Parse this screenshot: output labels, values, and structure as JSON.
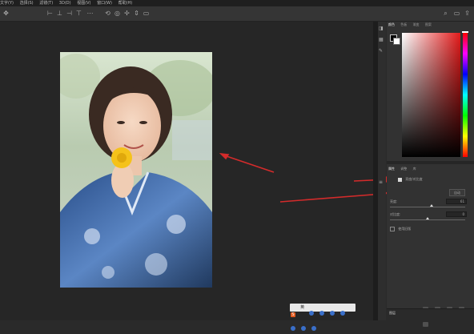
{
  "menubar": {
    "items": [
      "文字(Y)",
      "选择(S)",
      "滤镜(T)",
      "3D(D)",
      "视图(V)",
      "窗口(W)",
      "帮助(H)"
    ]
  },
  "options_bar": {
    "icons": [
      "move-tool",
      "align-left",
      "align-center",
      "align-right",
      "align-top",
      "align-middle",
      "align-bottom",
      "more-dots",
      "3d-rotate",
      "3d-roll",
      "3d-pan",
      "3d-slide",
      "3d-scale",
      "video-icon"
    ]
  },
  "color_panel": {
    "tabs": [
      "颜色",
      "色板",
      "渐变",
      "图案"
    ],
    "active_tab": "颜色",
    "gradient_hue": "#e31b1b"
  },
  "properties_panel": {
    "tabs": [
      "属性",
      "调整",
      "库"
    ],
    "active_tab": "属性",
    "layer_type": "亮度/对比度",
    "auto_button": "自动",
    "brightness_label": "亮度:",
    "brightness_value": "61",
    "brightness_fraction": 0.55,
    "contrast_label": "对比度:",
    "contrast_value": "0",
    "contrast_fraction": 0.5,
    "legacy_label": "使用旧版"
  },
  "taskbar": {
    "ime_label": "S",
    "ime_mode": "英"
  },
  "status": {
    "layer_label": "图层"
  },
  "colors": {
    "arrow_red": "#d42b2b",
    "accent_orange": "#e35a1f"
  }
}
